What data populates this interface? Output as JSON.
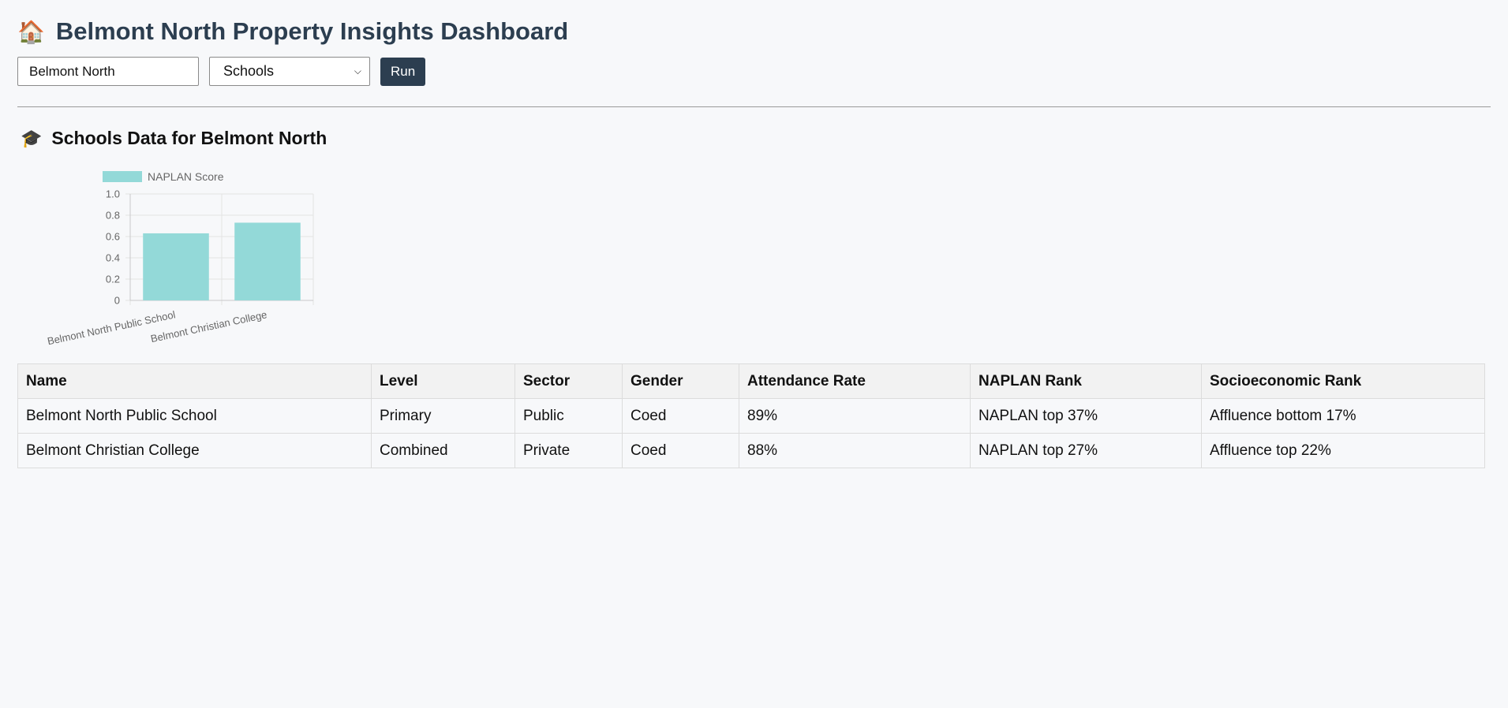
{
  "header": {
    "emoji": "🏠",
    "title": "Belmont North Property Insights Dashboard"
  },
  "controls": {
    "suburb_value": "Belmont North",
    "category_selected": "Schools",
    "run_label": "Run"
  },
  "section": {
    "emoji": "🎓",
    "title": "Schools Data for Belmont North"
  },
  "chart_data": {
    "type": "bar",
    "categories": [
      "Belmont North Public School",
      "Belmont Christian College"
    ],
    "series": [
      {
        "name": "NAPLAN Score",
        "values": [
          0.63,
          0.73
        ],
        "color": "#93d9d8"
      }
    ],
    "ylim": [
      0,
      1
    ],
    "yticks": [
      "0",
      "0.2",
      "0.4",
      "0.6",
      "0.8",
      "1.0"
    ],
    "legend": "top",
    "grid": true
  },
  "table": {
    "headers": [
      "Name",
      "Level",
      "Sector",
      "Gender",
      "Attendance Rate",
      "NAPLAN Rank",
      "Socioeconomic Rank"
    ],
    "rows": [
      [
        "Belmont North Public School",
        "Primary",
        "Public",
        "Coed",
        "89%",
        "NAPLAN top 37%",
        "Affluence bottom 17%"
      ],
      [
        "Belmont Christian College",
        "Combined",
        "Private",
        "Coed",
        "88%",
        "NAPLAN top 27%",
        "Affluence top 22%"
      ]
    ]
  }
}
